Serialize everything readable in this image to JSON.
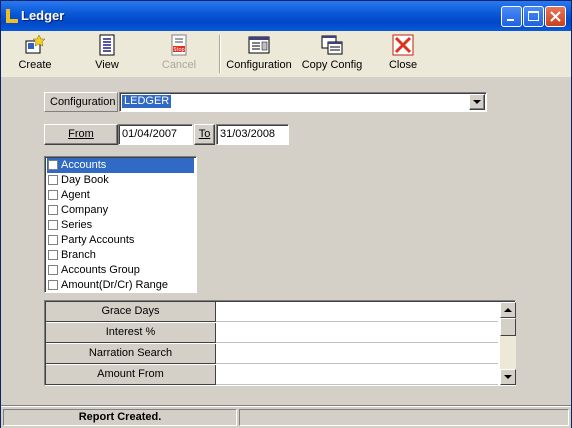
{
  "window": {
    "title": "Ledger"
  },
  "toolbar": {
    "create": "Create",
    "view": "View",
    "cancel": "Cancel",
    "configuration": "Configuration",
    "copy_config": "Copy Config",
    "close": "Close"
  },
  "config": {
    "label": "Configuration",
    "value": "LEDGER"
  },
  "dates": {
    "from_label": "From",
    "from_value": "01/04/2007",
    "to_label": "To",
    "to_value": "31/03/2008"
  },
  "list": {
    "items": [
      "Accounts",
      "Day Book",
      "Agent",
      "Company",
      "Series",
      "Party Accounts",
      "Branch",
      "Accounts Group",
      "Amount(Dr/Cr) Range"
    ],
    "selected_index": 0
  },
  "grid": {
    "rows": [
      {
        "label": "Grace Days",
        "value": ""
      },
      {
        "label": "Interest %",
        "value": ""
      },
      {
        "label": "Narration Search",
        "value": ""
      },
      {
        "label": "Amount From",
        "value": ""
      }
    ]
  },
  "status": {
    "text": "Report Created."
  },
  "colors": {
    "title_blue": "#0a5ad8",
    "selection": "#316ac5",
    "close_red": "#e0301e"
  }
}
